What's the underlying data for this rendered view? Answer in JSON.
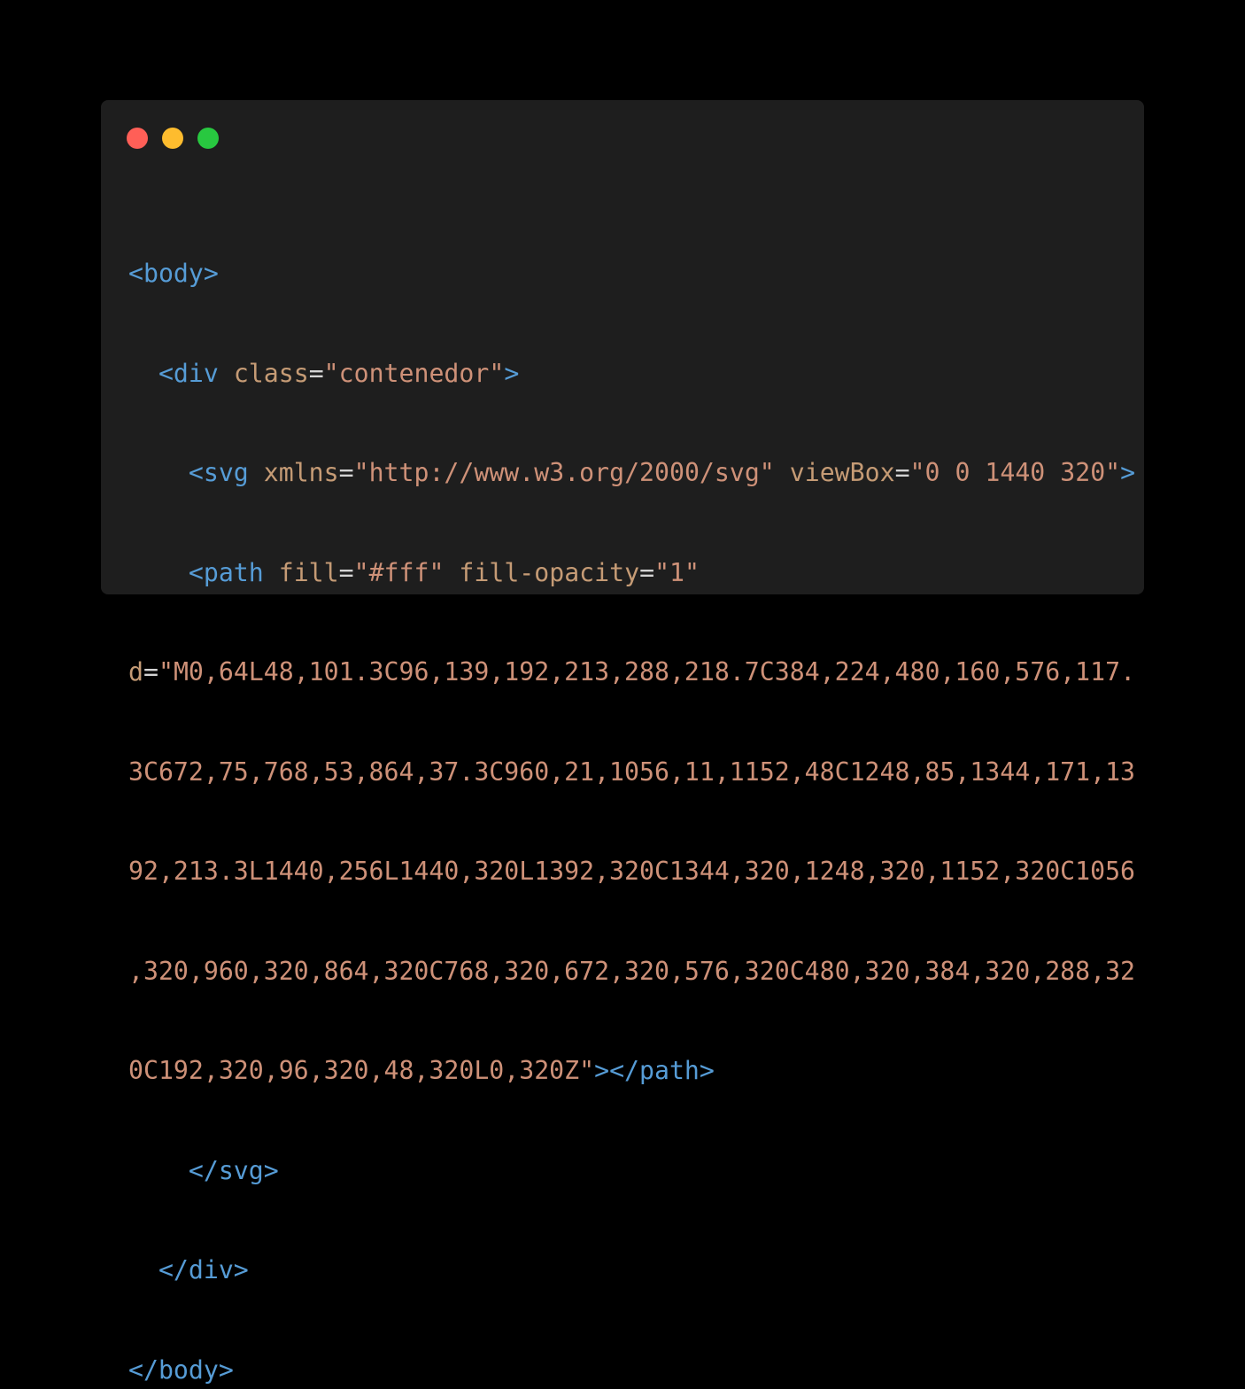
{
  "window": {
    "background": "#1e1e1e",
    "traffic_lights": [
      {
        "name": "close",
        "color": "#ff5f57"
      },
      {
        "name": "minimize",
        "color": "#febc2e"
      },
      {
        "name": "maximize",
        "color": "#28c840"
      }
    ]
  },
  "colors": {
    "tag": "#569cd6",
    "attribute": "#c59b75",
    "string": "#ce9178",
    "equals": "#d4d4d4"
  },
  "code": {
    "l1": {
      "open": "<body>"
    },
    "l2": {
      "indent": "  ",
      "tag": "<div",
      "attr": "class",
      "eq": "=",
      "val": "\"contenedor\"",
      "close": ">"
    },
    "l3": {
      "indent": "    ",
      "tag": "<svg",
      "attr1": "xmlns",
      "eq1": "=",
      "val1": "\"http://www.w3.org/2000/svg\"",
      "attr2": "viewBox",
      "eq2": "=",
      "val2": "\"0 0 1440 320\"",
      "close": ">"
    },
    "l4": {
      "indent": "    ",
      "tag": "<path",
      "attr1": "fill",
      "eq1": "=",
      "val1": "\"#fff\"",
      "attr2": "fill-opacity",
      "eq2": "=",
      "val2": "\"1\""
    },
    "l5": {
      "attr": "d",
      "eq": "=",
      "val": "\"M0,64L48,101.3C96,139,192,213,288,218.7C384,224,480,160,576,117."
    },
    "l6": {
      "val": "3C672,75,768,53,864,37.3C960,21,1056,11,1152,48C1248,85,1344,171,13"
    },
    "l7": {
      "val": "92,213.3L1440,256L1440,320L1392,320C1344,320,1248,320,1152,320C1056"
    },
    "l8": {
      "val": ",320,960,320,864,320C768,320,672,320,576,320C480,320,384,320,288,32"
    },
    "l9": {
      "val": "0C192,320,96,320,48,320L0,320Z\"",
      "close": "></path>"
    },
    "l10": {
      "indent": "    ",
      "close": "</svg>"
    },
    "l11": {
      "indent": "  ",
      "close": "</div>"
    },
    "l12": {
      "close": "</body>"
    }
  }
}
